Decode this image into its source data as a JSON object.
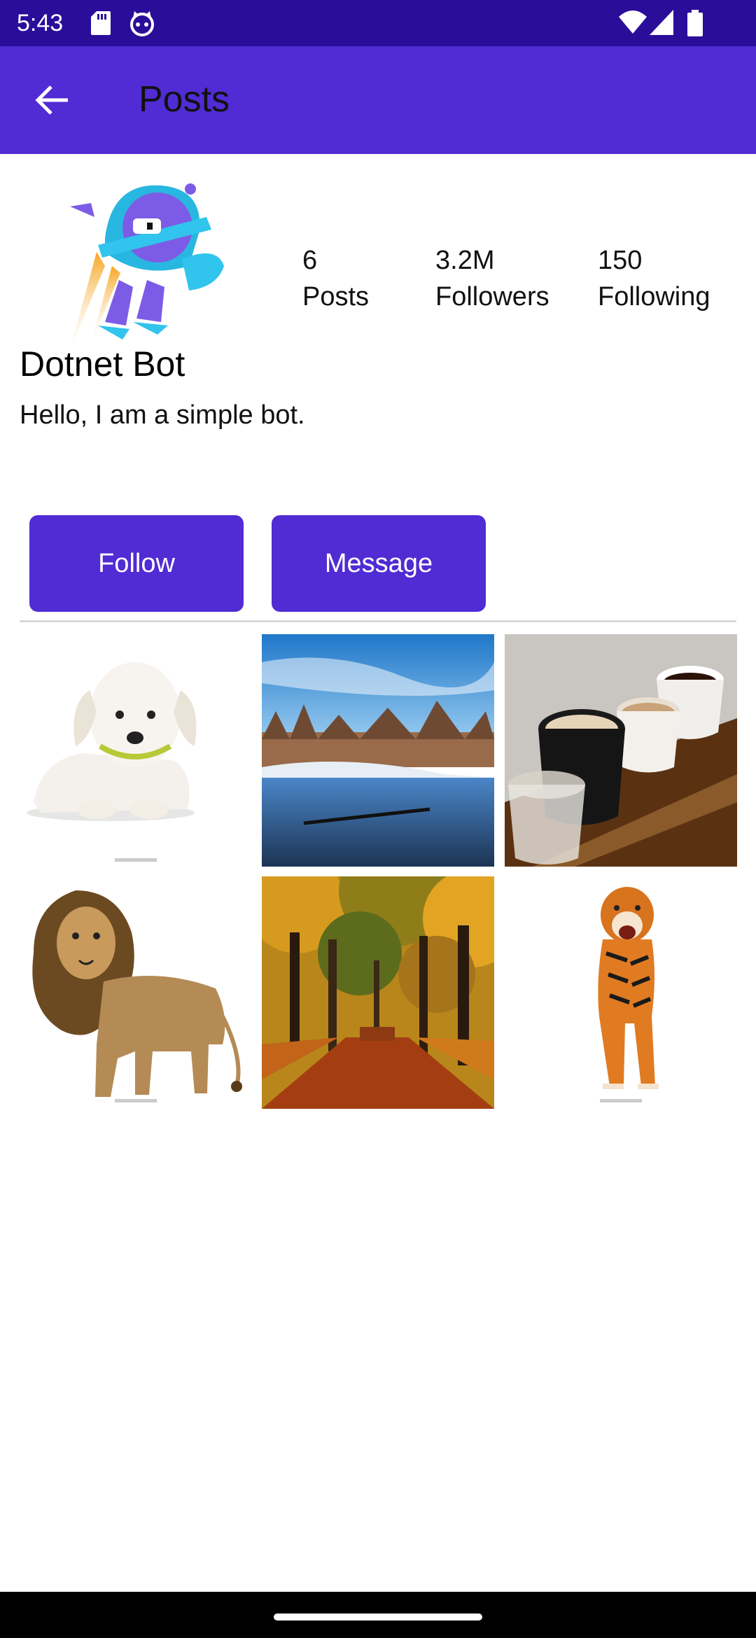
{
  "status_bar": {
    "time": "5:43",
    "icons": [
      "sd-card-icon",
      "cat-face-icon",
      "wifi-icon",
      "signal-icon",
      "battery-icon"
    ],
    "background": "#2a0e9a"
  },
  "app_bar": {
    "title": "Posts",
    "back_icon": "arrow-left-icon",
    "background": "#512bd4"
  },
  "profile": {
    "avatar_icon": "dotnet-bot-avatar-icon",
    "name": "Dotnet Bot",
    "bio": "Hello, I am a simple bot.",
    "stats": {
      "posts_value": "6",
      "posts_label": "Posts",
      "followers_value": "3.2M",
      "followers_label": "Followers",
      "following_value": "150",
      "following_label": "Following"
    }
  },
  "actions": {
    "follow_label": "Follow",
    "message_label": "Message",
    "button_color": "#512bd4"
  },
  "posts": [
    {
      "subject": "puppy-photo"
    },
    {
      "subject": "river-landscape-photo"
    },
    {
      "subject": "coffee-cups-photo"
    },
    {
      "subject": "lion-photo"
    },
    {
      "subject": "autumn-forest-photo"
    },
    {
      "subject": "tiger-photo"
    }
  ]
}
